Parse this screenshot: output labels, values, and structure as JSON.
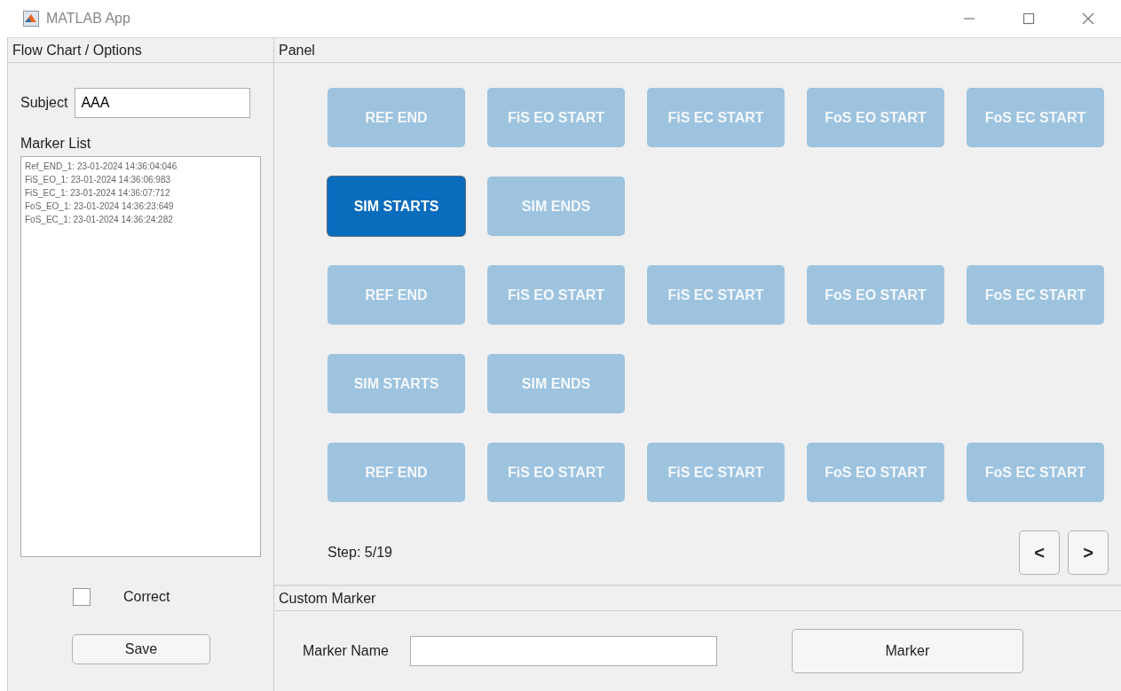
{
  "window": {
    "title": "MATLAB App"
  },
  "left_panel": {
    "title": "Flow Chart / Options",
    "subject": {
      "label": "Subject",
      "value": "AAA"
    },
    "marker_list": {
      "label": "Marker List",
      "items": [
        "Ref_END_1: 23-01-2024 14:36:04:046",
        "FiS_EO_1: 23-01-2024 14:36:06:983",
        "FiS_EC_1: 23-01-2024 14:36:07:712",
        "FoS_EO_1: 23-01-2024 14:36:23:649",
        "FoS_EC_1: 23-01-2024 14:36:24:282"
      ]
    },
    "correct": {
      "label": "Correct",
      "checked": false
    },
    "save_button": "Save"
  },
  "panel": {
    "title": "Panel",
    "rows": [
      [
        {
          "label": "REF END",
          "selected": false
        },
        {
          "label": "FiS EO START",
          "selected": false
        },
        {
          "label": "FiS EC START",
          "selected": false
        },
        {
          "label": "FoS EO START",
          "selected": false
        },
        {
          "label": "FoS EC START",
          "selected": false
        }
      ],
      [
        {
          "label": "SIM STARTS",
          "selected": true
        },
        {
          "label": "SIM ENDS",
          "selected": false
        }
      ],
      [
        {
          "label": "REF END",
          "selected": false
        },
        {
          "label": "FiS EO START",
          "selected": false
        },
        {
          "label": "FiS EC START",
          "selected": false
        },
        {
          "label": "FoS EO START",
          "selected": false
        },
        {
          "label": "FoS EC START",
          "selected": false
        }
      ],
      [
        {
          "label": "SIM STARTS",
          "selected": false
        },
        {
          "label": "SIM ENDS",
          "selected": false
        }
      ],
      [
        {
          "label": "REF END",
          "selected": false
        },
        {
          "label": "FiS EO START",
          "selected": false
        },
        {
          "label": "FiS EC START",
          "selected": false
        },
        {
          "label": "FoS EO START",
          "selected": false
        },
        {
          "label": "FoS EC START",
          "selected": false
        }
      ]
    ],
    "step": "Step: 5/19",
    "prev": "<",
    "next": ">"
  },
  "custom_marker": {
    "title": "Custom Marker",
    "name_label": "Marker Name",
    "marker_button": "Marker"
  }
}
